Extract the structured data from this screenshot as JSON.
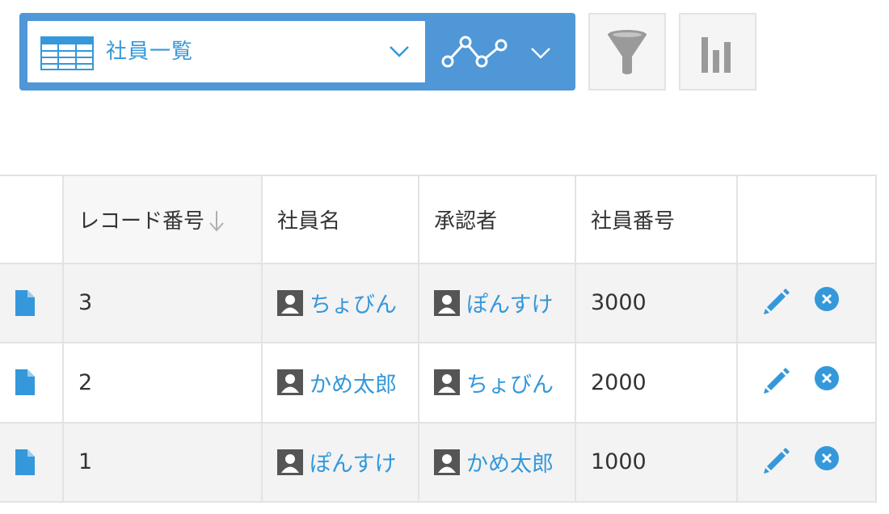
{
  "view": {
    "name": "社員一覧",
    "icons": {
      "view_list": "table-icon",
      "graph": "line-graph-icon",
      "filter": "funnel-icon",
      "stats": "bar-chart-icon"
    }
  },
  "colors": {
    "accent": "#4f97d7",
    "link": "#3498db",
    "row_shade": "#f3f3f3",
    "border": "#e3e3e3"
  },
  "table": {
    "headers": {
      "record_no": "レコード番号",
      "employee_name": "社員名",
      "approver": "承認者",
      "employee_no": "社員番号"
    },
    "sort": {
      "column": "record_no",
      "direction": "descending"
    },
    "rows": [
      {
        "record_no": "3",
        "employee_name": "ちょびん",
        "approver": "ぽんすけ",
        "employee_no": "3000"
      },
      {
        "record_no": "2",
        "employee_name": "かめ太郎",
        "approver": "ちょびん",
        "employee_no": "2000"
      },
      {
        "record_no": "1",
        "employee_name": "ぽんすけ",
        "approver": "かめ太郎",
        "employee_no": "1000"
      }
    ]
  }
}
